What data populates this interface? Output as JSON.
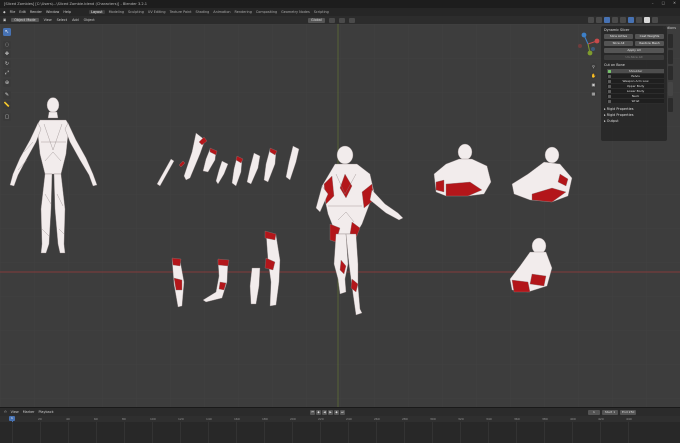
{
  "titlebar": {
    "title": "[Sliced Zombies] [C:\\Users\\...\\Sliced Zombie.blend (Characters)] - Blender 3.2.1",
    "controls": [
      "–",
      "□",
      "✕"
    ]
  },
  "menubar": {
    "items": [
      "File",
      "Edit",
      "Render",
      "Window",
      "Help"
    ],
    "workspaces": [
      "Layout",
      "Modeling",
      "Sculpting",
      "UV Editing",
      "Texture Paint",
      "Shading",
      "Animation",
      "Rendering",
      "Compositing",
      "Geometry Nodes",
      "Scripting"
    ],
    "active_workspace": "Layout"
  },
  "header": {
    "mode": "Object Mode",
    "menus": [
      "View",
      "Select",
      "Add",
      "Object"
    ],
    "transform": "Global",
    "options_label": "Options"
  },
  "toolbar": {
    "icons": [
      "cursor-icon",
      "select-box-icon",
      "move-icon",
      "rotate-icon",
      "scale-icon",
      "transform-icon",
      "annotate-icon",
      "measure-icon",
      "add-cube-icon"
    ]
  },
  "npanel": {
    "section_title": "Dynamic Slicer",
    "buttons_row1": [
      "Slice Active",
      "Cast Weights"
    ],
    "buttons_row2": [
      "Slice All",
      "Restore Mesh"
    ],
    "apply_label": "Apply All",
    "disabled_label": "Un-Slice All",
    "cut_section": "Cut on Bone",
    "bone_list": [
      "Shoulder",
      "Pelvis",
      "Weapon Arm Low",
      "Upper Body",
      "Lower Body",
      "Neck",
      "Wrist"
    ],
    "selected_index": 0,
    "collapsed_sections": [
      "Rigid Properties",
      "Rigid Properties",
      "Output"
    ]
  },
  "timeline": {
    "menus": [
      "View",
      "Marker",
      "Playback"
    ],
    "current_frame": "1",
    "start_label": "Start",
    "start_value": "1",
    "end_label": "End",
    "end_value": "250",
    "ruler": [
      "0",
      "20",
      "40",
      "60",
      "80",
      "100",
      "120",
      "140",
      "160",
      "180",
      "200",
      "220",
      "240",
      "260",
      "280",
      "300",
      "320",
      "340",
      "360",
      "380",
      "400",
      "420",
      "440"
    ]
  },
  "colors": {
    "background": "#3d3d3d",
    "accent": "#4772b3",
    "mesh_white": "#f2ecec",
    "mesh_red": "#b3161a",
    "axis_red": "#9a3b3b",
    "axis_green": "#7f9b2e"
  }
}
